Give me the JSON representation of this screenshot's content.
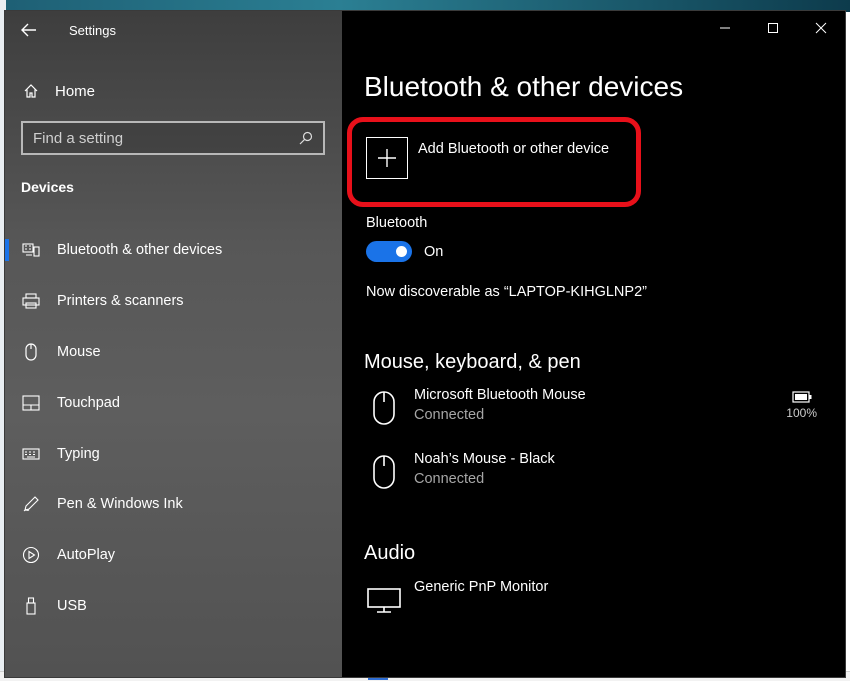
{
  "window": {
    "app_title": "Settings",
    "controls": {
      "minimize": "—",
      "maximize": "☐",
      "close": "✕"
    }
  },
  "sidebar": {
    "home_label": "Home",
    "search_placeholder": "Find a setting",
    "section_heading": "Devices",
    "items": [
      {
        "label": "Bluetooth & other devices",
        "icon": "bluetooth-devices-icon",
        "selected": true
      },
      {
        "label": "Printers & scanners",
        "icon": "printer-icon",
        "selected": false
      },
      {
        "label": "Mouse",
        "icon": "mouse-icon",
        "selected": false
      },
      {
        "label": "Touchpad",
        "icon": "touchpad-icon",
        "selected": false
      },
      {
        "label": "Typing",
        "icon": "keyboard-icon",
        "selected": false
      },
      {
        "label": "Pen & Windows Ink",
        "icon": "pen-icon",
        "selected": false
      },
      {
        "label": "AutoPlay",
        "icon": "autoplay-icon",
        "selected": false
      },
      {
        "label": "USB",
        "icon": "usb-icon",
        "selected": false
      }
    ]
  },
  "main": {
    "title": "Bluetooth & other devices",
    "add_device_label": "Add Bluetooth or other device",
    "bluetooth": {
      "label": "Bluetooth",
      "state": "On",
      "discoverable": "Now discoverable as “LAPTOP-KIHGLNP2”"
    },
    "mouse_section": {
      "title": "Mouse, keyboard, & pen",
      "devices": [
        {
          "name": "Microsoft Bluetooth Mouse",
          "status": "Connected",
          "battery": "100%"
        },
        {
          "name": "Noah’s Mouse - Black",
          "status": "Connected"
        }
      ]
    },
    "audio_section": {
      "title": "Audio",
      "devices": [
        {
          "name": "Generic PnP Monitor"
        }
      ]
    }
  },
  "colors": {
    "accent": "#1a73e8",
    "highlight": "#e8101a",
    "main_bg": "#000000",
    "sidebar_bg": "#555555"
  }
}
